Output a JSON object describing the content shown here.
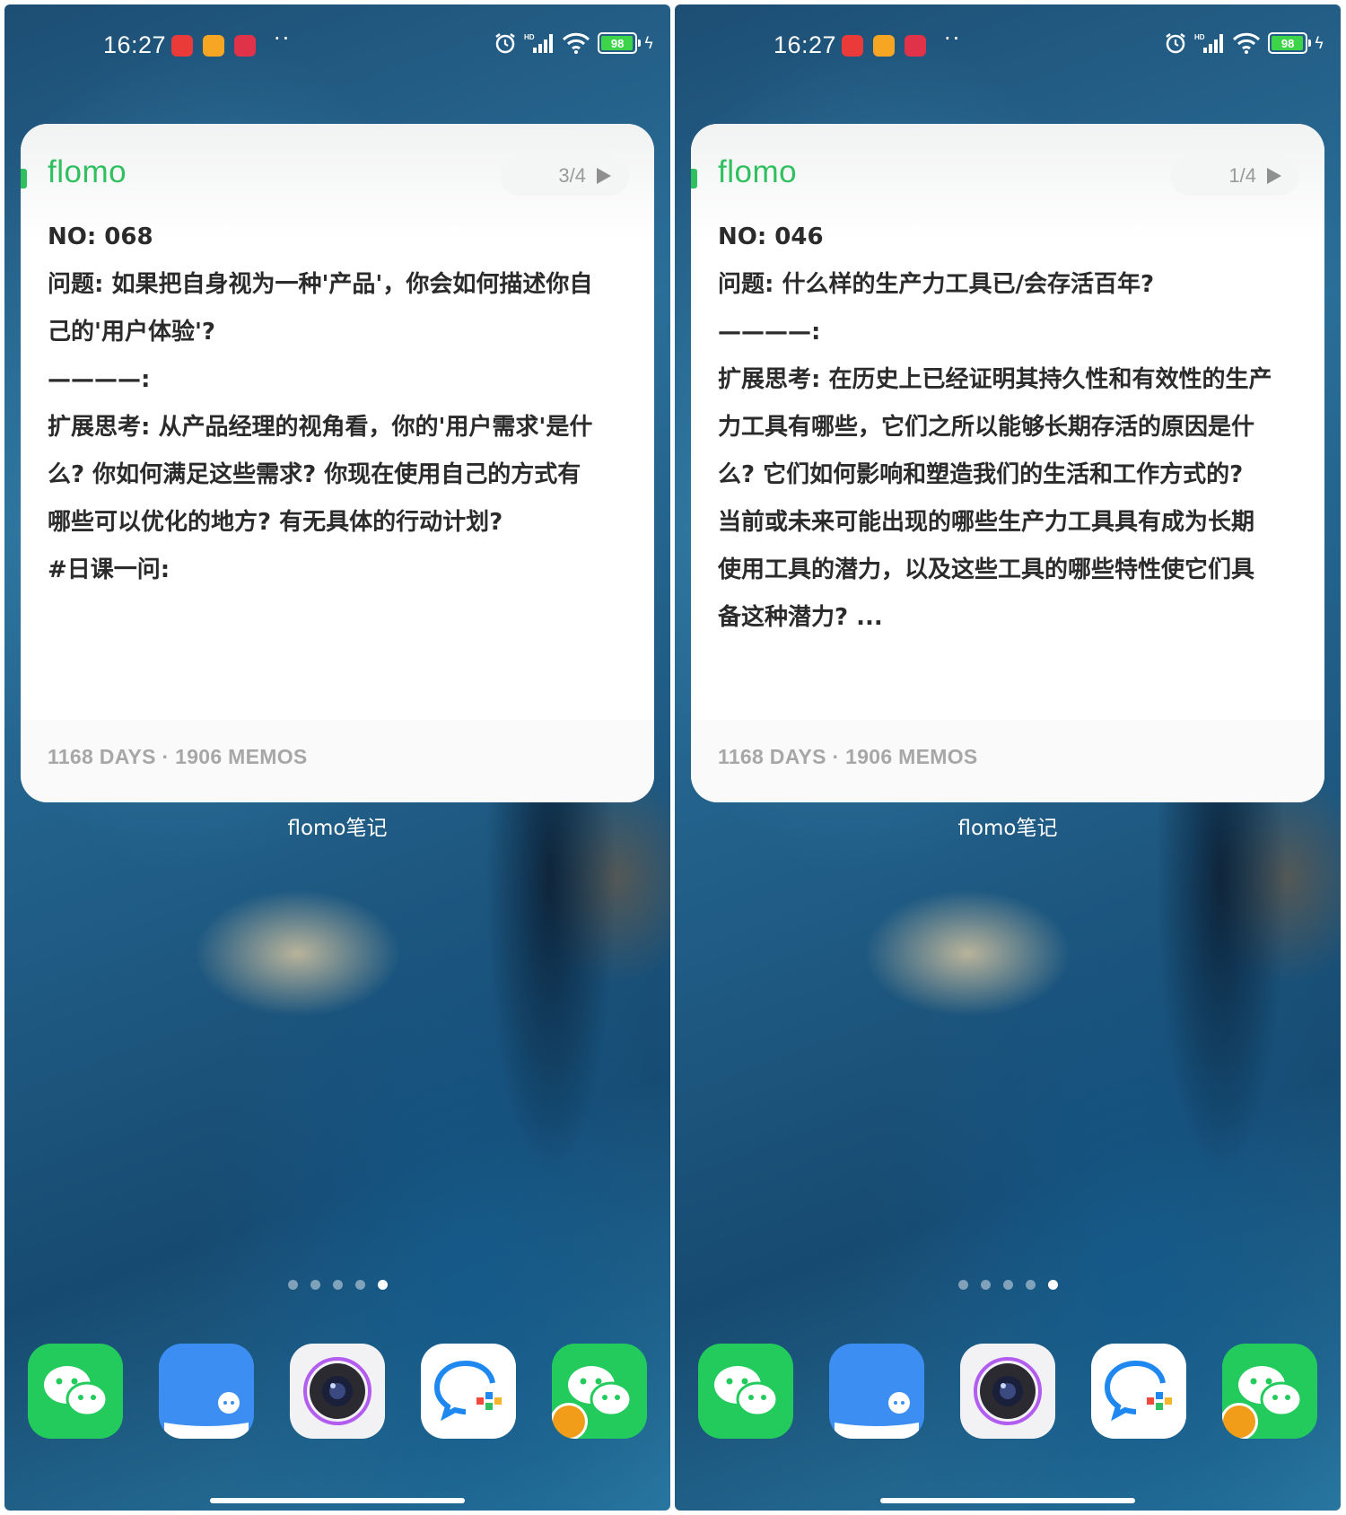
{
  "status_bar": {
    "time": "16:27",
    "battery": "98",
    "battery_level": 0.98
  },
  "screens": [
    {
      "widget": {
        "brand": "flomo",
        "pager": "3/4",
        "memo_lines": [
          "NO: 068",
          "问题: 如果把自身视为一种'产品'，你会如何描述你自",
          "己的'用户体验'?",
          "————:",
          "扩展思考: 从产品经理的视角看，你的'用户需求'是什",
          "么? 你如何满足这些需求? 你现在使用自己的方式有",
          "哪些可以优化的地方? 有无具体的行动计划?",
          "#日课一问:"
        ],
        "footer": "1168 DAYS · 1906 MEMOS"
      },
      "widget_label": "flomo笔记"
    },
    {
      "widget": {
        "brand": "flomo",
        "pager": "1/4",
        "memo_lines": [
          "NO: 046",
          "问题: 什么样的生产力工具已/会存活百年?",
          "————:",
          "扩展思考: 在历史上已经证明其持久性和有效性的生产",
          "力工具有哪些，它们之所以能够长期存活的原因是什",
          "么? 它们如何影响和塑造我们的生活和工作方式的?",
          "当前或未来可能出现的哪些生产力工具具有成为长期",
          "使用工具的潜力，以及这些工具的哪些特性使它们具",
          "备这种潜力? ..."
        ],
        "footer": "1168 DAYS · 1906 MEMOS"
      },
      "widget_label": "flomo笔记"
    }
  ],
  "page_indicator": {
    "count": 5,
    "active_index": 4
  },
  "dock_apps": [
    "wechat-icon",
    "feishu-icon",
    "camera-icon",
    "messenger-icon",
    "wechat-clone-icon"
  ],
  "colors": {
    "brand_green": "#30c060",
    "battery_green": "#3dd44a"
  }
}
